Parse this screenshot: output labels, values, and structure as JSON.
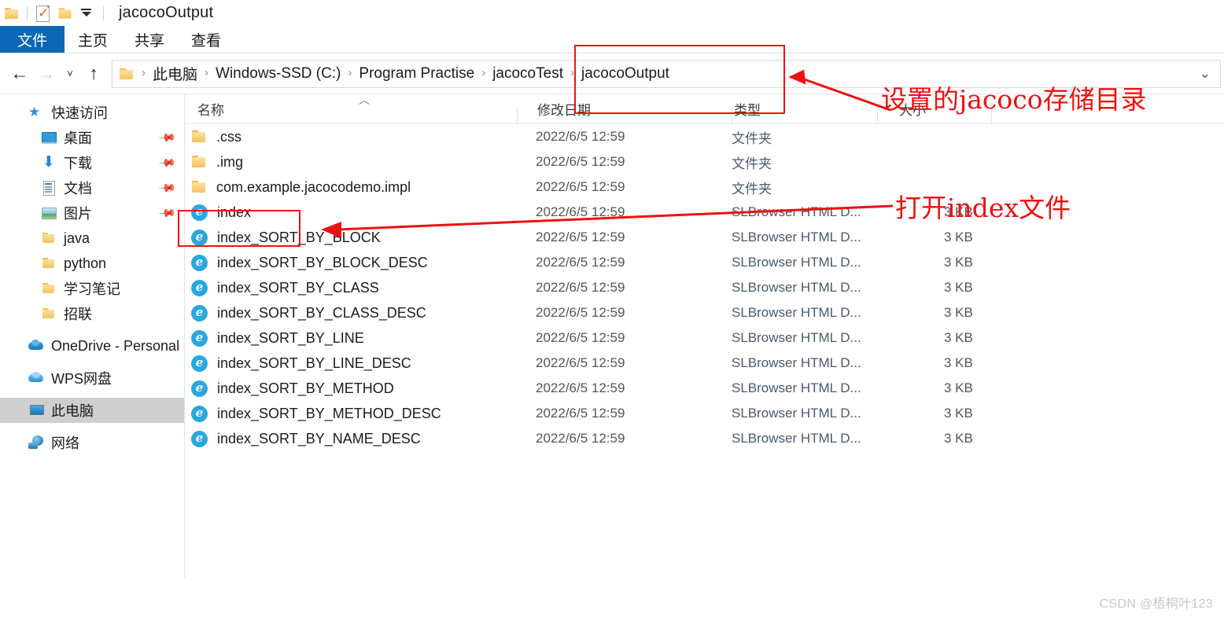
{
  "window": {
    "title": "jacocoOutput",
    "qat": [
      {
        "name": "folder-icon",
        "label": ""
      },
      {
        "name": "properties-icon",
        "label": ""
      },
      {
        "name": "new-folder-icon",
        "label": ""
      },
      {
        "name": "customize-qat-dropdown",
        "label": ""
      }
    ]
  },
  "ribbon": {
    "tabs": [
      {
        "label": "文件",
        "active": true
      },
      {
        "label": "主页",
        "active": false
      },
      {
        "label": "共享",
        "active": false
      },
      {
        "label": "查看",
        "active": false
      }
    ]
  },
  "navigation": {
    "back": "←",
    "forward": "→",
    "recent": "˅",
    "up": "↑",
    "breadcrumbs": [
      "此电脑",
      "Windows-SSD (C:)",
      "Program Practise",
      "jacocoTest",
      "jacocoOutput"
    ],
    "separator": "›",
    "dropdown": "⌄"
  },
  "sidebar": {
    "items": [
      {
        "label": "快速访问",
        "icon": "star-icon",
        "indent": false,
        "pinned": false,
        "selected": false
      },
      {
        "label": "桌面",
        "icon": "desktop-icon",
        "indent": true,
        "pinned": true,
        "selected": false
      },
      {
        "label": "下载",
        "icon": "download-icon",
        "indent": true,
        "pinned": true,
        "selected": false
      },
      {
        "label": "文档",
        "icon": "documents-icon",
        "indent": true,
        "pinned": true,
        "selected": false
      },
      {
        "label": "图片",
        "icon": "pictures-icon",
        "indent": true,
        "pinned": true,
        "selected": false
      },
      {
        "label": "java",
        "icon": "folder-icon",
        "indent": true,
        "pinned": false,
        "selected": false
      },
      {
        "label": "python",
        "icon": "folder-icon",
        "indent": true,
        "pinned": false,
        "selected": false
      },
      {
        "label": "学习笔记",
        "icon": "folder-icon",
        "indent": true,
        "pinned": false,
        "selected": false
      },
      {
        "label": "招联",
        "icon": "folder-icon",
        "indent": true,
        "pinned": false,
        "selected": false
      },
      {
        "label": "OneDrive - Personal",
        "icon": "onedrive-icon",
        "indent": false,
        "pinned": false,
        "selected": false
      },
      {
        "label": "WPS网盘",
        "icon": "wps-cloud-icon",
        "indent": false,
        "pinned": false,
        "selected": false
      },
      {
        "label": "此电脑",
        "icon": "this-pc-icon",
        "indent": false,
        "pinned": false,
        "selected": true
      },
      {
        "label": "网络",
        "icon": "network-icon",
        "indent": false,
        "pinned": false,
        "selected": false
      }
    ],
    "pin_glyph": "📌"
  },
  "filelist": {
    "sort_indicator": "︿",
    "columns": [
      {
        "label": "名称"
      },
      {
        "label": "修改日期"
      },
      {
        "label": "类型"
      },
      {
        "label": "大小"
      }
    ],
    "rows": [
      {
        "name": ".css",
        "icon": "folder-icon",
        "date": "2022/6/5 12:59",
        "type": "文件夹",
        "size": ""
      },
      {
        "name": ".img",
        "icon": "folder-icon",
        "date": "2022/6/5 12:59",
        "type": "文件夹",
        "size": ""
      },
      {
        "name": "com.example.jacocodemo.impl",
        "icon": "folder-icon",
        "date": "2022/6/5 12:59",
        "type": "文件夹",
        "size": ""
      },
      {
        "name": "index",
        "icon": "slbrowser-html-icon",
        "date": "2022/6/5 12:59",
        "type": "SLBrowser HTML D...",
        "size": "3 KB"
      },
      {
        "name": "index_SORT_BY_BLOCK",
        "icon": "slbrowser-html-icon",
        "date": "2022/6/5 12:59",
        "type": "SLBrowser HTML D...",
        "size": "3 KB"
      },
      {
        "name": "index_SORT_BY_BLOCK_DESC",
        "icon": "slbrowser-html-icon",
        "date": "2022/6/5 12:59",
        "type": "SLBrowser HTML D...",
        "size": "3 KB"
      },
      {
        "name": "index_SORT_BY_CLASS",
        "icon": "slbrowser-html-icon",
        "date": "2022/6/5 12:59",
        "type": "SLBrowser HTML D...",
        "size": "3 KB"
      },
      {
        "name": "index_SORT_BY_CLASS_DESC",
        "icon": "slbrowser-html-icon",
        "date": "2022/6/5 12:59",
        "type": "SLBrowser HTML D...",
        "size": "3 KB"
      },
      {
        "name": "index_SORT_BY_LINE",
        "icon": "slbrowser-html-icon",
        "date": "2022/6/5 12:59",
        "type": "SLBrowser HTML D...",
        "size": "3 KB"
      },
      {
        "name": "index_SORT_BY_LINE_DESC",
        "icon": "slbrowser-html-icon",
        "date": "2022/6/5 12:59",
        "type": "SLBrowser HTML D...",
        "size": "3 KB"
      },
      {
        "name": "index_SORT_BY_METHOD",
        "icon": "slbrowser-html-icon",
        "date": "2022/6/5 12:59",
        "type": "SLBrowser HTML D...",
        "size": "3 KB"
      },
      {
        "name": "index_SORT_BY_METHOD_DESC",
        "icon": "slbrowser-html-icon",
        "date": "2022/6/5 12:59",
        "type": "SLBrowser HTML D...",
        "size": "3 KB"
      },
      {
        "name": "index_SORT_BY_NAME_DESC",
        "icon": "slbrowser-html-icon",
        "date": "2022/6/5 12:59",
        "type": "SLBrowser HTML D...",
        "size": "3 KB"
      }
    ]
  },
  "annotations": {
    "color": "#ee1111",
    "path_note": "设置的jacoco存储目录",
    "index_note": "打开index文件"
  },
  "watermark": "CSDN @梧桐叶123"
}
